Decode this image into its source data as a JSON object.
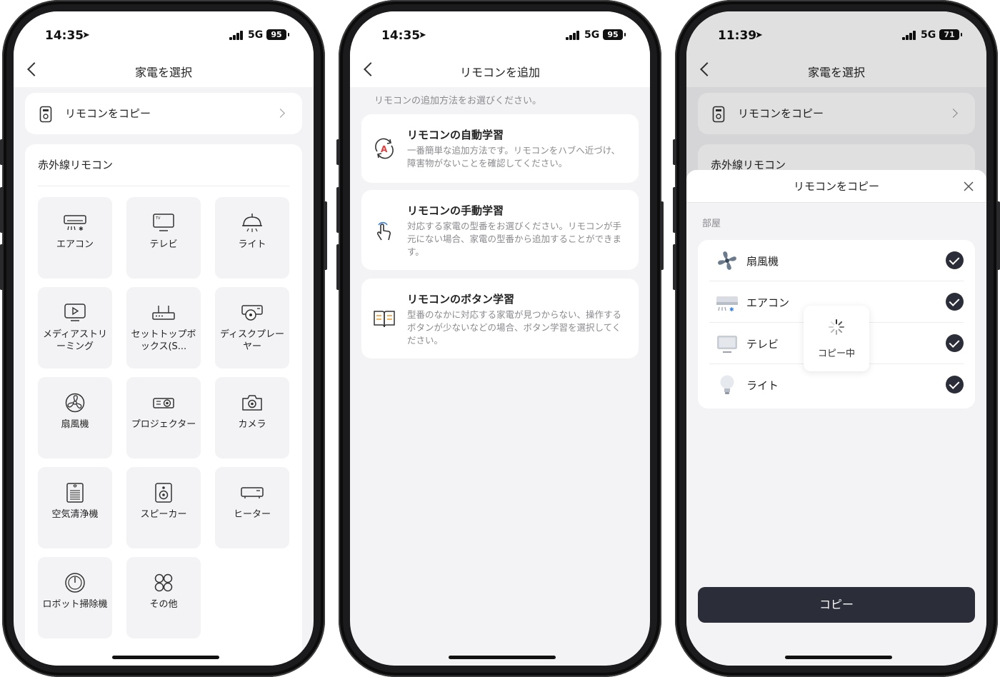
{
  "screen1": {
    "status": {
      "time": "14:35",
      "network": "5G",
      "battery": "95"
    },
    "nav_title": "家電を選択",
    "copy_remote_label": "リモコンをコピー",
    "ir_section_title": "赤外線リモコン",
    "tiles": [
      {
        "icon": "air-conditioner-icon",
        "label": "エアコン"
      },
      {
        "icon": "tv-icon",
        "label": "テレビ"
      },
      {
        "icon": "light-icon",
        "label": "ライト"
      },
      {
        "icon": "media-streaming-icon",
        "label": "メディアストリーミング"
      },
      {
        "icon": "set-top-box-icon",
        "label": "セットトップボックス(S..."
      },
      {
        "icon": "disc-player-icon",
        "label": "ディスクプレーヤー"
      },
      {
        "icon": "fan-icon",
        "label": "扇風機"
      },
      {
        "icon": "projector-icon",
        "label": "プロジェクター"
      },
      {
        "icon": "camera-icon",
        "label": "カメラ"
      },
      {
        "icon": "air-purifier-icon",
        "label": "空気清浄機"
      },
      {
        "icon": "speaker-icon",
        "label": "スピーカー"
      },
      {
        "icon": "heater-icon",
        "label": "ヒーター"
      },
      {
        "icon": "robot-vacuum-icon",
        "label": "ロボット掃除機"
      },
      {
        "icon": "other-icon",
        "label": "その他"
      }
    ]
  },
  "screen2": {
    "status": {
      "time": "14:35",
      "network": "5G",
      "battery": "95"
    },
    "nav_title": "リモコンを追加",
    "hint": "リモコンの追加方法をお選びください。",
    "methods": [
      {
        "icon": "auto-learn-icon",
        "title": "リモコンの自動学習",
        "desc": "一番簡単な追加方法です。リモコンをハブへ近づけ、障害物がないことを確認してください。"
      },
      {
        "icon": "manual-learn-icon",
        "title": "リモコンの手動学習",
        "desc": "対応する家電の型番をお選びください。リモコンが手元にない場合、家電の型番から追加することができます。"
      },
      {
        "icon": "button-learn-icon",
        "title": "リモコンのボタン学習",
        "desc": "型番のなかに対応する家電が見つからない、操作するボタンが少ないなどの場合、ボタン学習を選択してください。"
      }
    ]
  },
  "screen3": {
    "status": {
      "time": "11:39",
      "network": "5G",
      "battery": "71"
    },
    "nav_title": "家電を選択",
    "copy_remote_label": "リモコンをコピー",
    "ir_section_title": "赤外線リモコン",
    "sheet_title": "リモコンをコピー",
    "room_label": "部屋",
    "devices": [
      {
        "icon": "fan-icon",
        "name": "扇風機",
        "checked": true
      },
      {
        "icon": "air-conditioner-icon",
        "name": "エアコン",
        "checked": true
      },
      {
        "icon": "tv-icon",
        "name": "テレビ",
        "checked": true
      },
      {
        "icon": "light-bulb-icon",
        "name": "ライト",
        "checked": true
      }
    ],
    "toast_text": "コピー中",
    "copy_button": "コピー"
  },
  "colors": {
    "accent_dark": "#2b2d38",
    "background": "#f3f3f5",
    "auto_learn_red": "#e03a3a",
    "manual_learn_blue": "#2f7de1",
    "button_learn_orange": "#f0a030"
  }
}
